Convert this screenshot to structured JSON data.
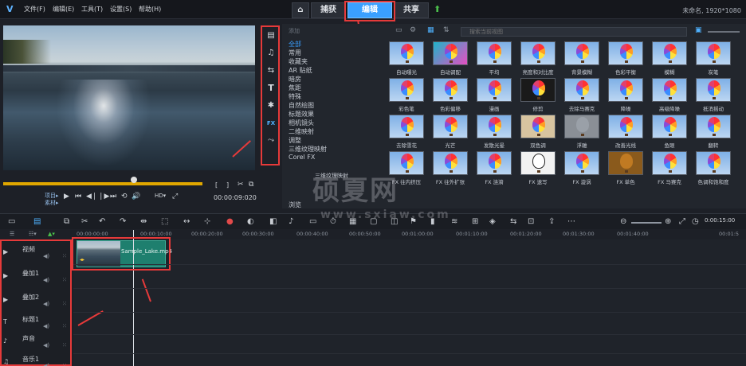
{
  "menubar": {
    "items": [
      "文件(F)",
      "编辑(E)",
      "工具(T)",
      "设置(S)",
      "帮助(H)"
    ],
    "status": "未命名, 1920*1080"
  },
  "tabs": {
    "home_icon": "home-icon",
    "items": [
      {
        "label": "捕获",
        "active": false
      },
      {
        "label": "编辑",
        "active": true
      },
      {
        "label": "共享",
        "active": false
      }
    ],
    "upload_icon": "green-up-arrow-icon"
  },
  "preview": {
    "project_label": "项目▸",
    "clip_label": "素材▸",
    "timecode": "00:00:09:020",
    "mark_in": "[",
    "mark_out": "]"
  },
  "side_toolbar": {
    "icons": [
      "media-icon",
      "instant-project-icon",
      "transition-icon",
      "title-icon",
      "graphic-icon",
      "filter-icon",
      "path-icon"
    ],
    "fx_label": "FX"
  },
  "library": {
    "add_label": "添加",
    "search_placeholder": "搜索当前视图",
    "categories": [
      "全部",
      "常用",
      "收藏夹",
      "AR 贴纸",
      "暗房",
      "焦距",
      "特殊",
      "自然绘图",
      "标题效果",
      "相机镜头",
      "二维映射",
      "调整",
      "三维纹理映射",
      "Corel FX"
    ],
    "selected_category": "全部",
    "tooltip": "三维纹理映射",
    "browse_label": "浏览",
    "filters": [
      "自动曝光",
      "自动调配",
      "平均",
      "亮度和对比度",
      "背景模糊",
      "色彩平衡",
      "模糊",
      "炭笔",
      "彩色笔",
      "色彩偏移",
      "漫画",
      "修剪",
      "去除马赛克",
      "降噪",
      "高级降噪",
      "抵消摇动",
      "去除雪花",
      "光芒",
      "发散光晕",
      "双色调",
      "浮雕",
      "改善光线",
      "鱼眼",
      "翻转",
      "FX 往内挤压",
      "FX 往外扩张",
      "FX 涟漪",
      "FX 速写",
      "FX 漩涡",
      "FX 单色",
      "FX 马赛克",
      "色调和饱和度"
    ]
  },
  "timeline": {
    "timecode": "0:00:15:00",
    "ruler": [
      "00:00:00:00",
      "00:00:10:00",
      "00:00:20:00",
      "00:00:30:00",
      "00:00:40:00",
      "00:00:50:00",
      "00:01:00:00",
      "00:01:10:00",
      "00:01:20:00",
      "00:01:30:00",
      "00:01:40:00",
      "00:01:5"
    ],
    "tracks": [
      "视频",
      "叠加1",
      "叠加2",
      "标题1",
      "声音",
      "音乐1"
    ],
    "clip_name": "Sample_Lake.mp4"
  },
  "watermark": {
    "line1": "硕夏网",
    "line2": "www.sxiaw.com"
  },
  "colors": {
    "accent": "#3aa0ff",
    "annotation": "#e63a3a",
    "clip": "#1e7f6e"
  }
}
